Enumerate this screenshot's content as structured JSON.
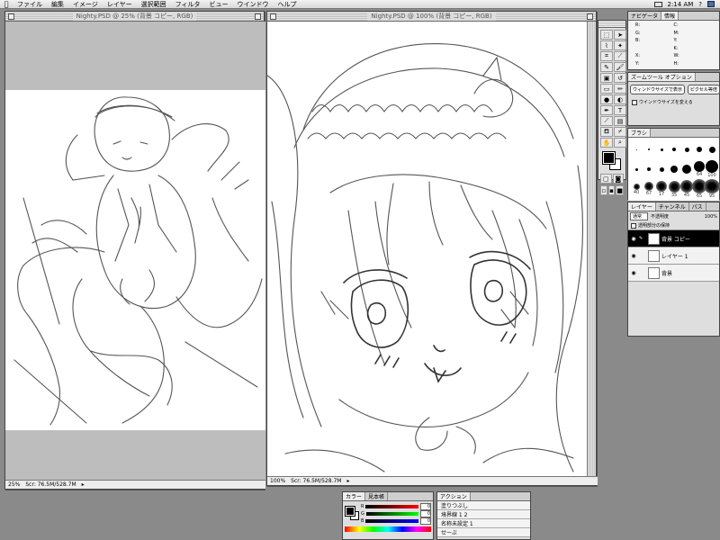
{
  "menubar": {
    "items": [
      "ファイル",
      "編集",
      "イメージ",
      "レイヤー",
      "選択範囲",
      "フィルタ",
      "ビュー",
      "ウインドウ",
      "ヘルプ"
    ],
    "clock": "2:14 AM"
  },
  "window_small": {
    "title": "Nighty.PSD @ 25% (背景 コピー, RGB)",
    "zoom": "25%",
    "status": "Scr: 76.5M/528.7M"
  },
  "window_large": {
    "title": "Nighty.PSD @ 100% (背景 コピー, RGB)",
    "zoom": "100%",
    "status": "Scr: 76.5M/528.7M"
  },
  "info_palette": {
    "tabs": [
      "ナビゲータ",
      "情報"
    ],
    "labels": [
      "R:",
      "G:",
      "B:",
      "C:",
      "M:",
      "Y:",
      "K:",
      "X:",
      "Y:",
      "W:",
      "H:"
    ]
  },
  "zoom_palette": {
    "tabs": [
      "ズームツール オプション"
    ],
    "buttons": [
      "ウィンドウサイズで表示",
      "ピクセル等倍"
    ],
    "checkbox": "ウインドウサイズを変える"
  },
  "brush_palette": {
    "tabs": [
      "ブラシ"
    ],
    "sizes": [
      "",
      "",
      "",
      "",
      "",
      "",
      "",
      "",
      "",
      "",
      "",
      "",
      "64",
      "100",
      "40",
      "67",
      "17",
      "35",
      "45",
      "65",
      "95"
    ]
  },
  "layers_palette": {
    "tabs": [
      "レイヤー",
      "チャンネル",
      "パス"
    ],
    "mode": "通常",
    "opacity_label": "不透明度",
    "opacity": "100%",
    "preserve": "透明部分の保持",
    "layers": [
      {
        "name": "背景 コピー",
        "selected": true
      },
      {
        "name": "レイヤー 1",
        "selected": false
      },
      {
        "name": "背景",
        "selected": false
      }
    ]
  },
  "color_palette": {
    "tabs": [
      "カラー",
      "見本帳"
    ],
    "channels": [
      "R",
      "G",
      "B"
    ],
    "values": [
      "0",
      "0",
      "0"
    ]
  },
  "actions_palette": {
    "tabs": [
      "アクション"
    ],
    "items": [
      "塗りつぶし",
      "境界線 1 2",
      "名称未設定 1",
      "せーぶ"
    ]
  },
  "toolbox_icons": [
    "marquee-icon",
    "move-icon",
    "lasso-icon",
    "magic-wand-icon",
    "crop-icon",
    "slice-icon",
    "airbrush-icon",
    "paintbrush-icon",
    "stamp-icon",
    "history-brush-icon",
    "eraser-icon",
    "pencil-icon",
    "blur-icon",
    "dodge-icon",
    "pen-icon",
    "type-icon",
    "measure-icon",
    "gradient-icon",
    "paint-bucket-icon",
    "eyedropper-icon",
    "hand-icon",
    "zoom-icon"
  ]
}
